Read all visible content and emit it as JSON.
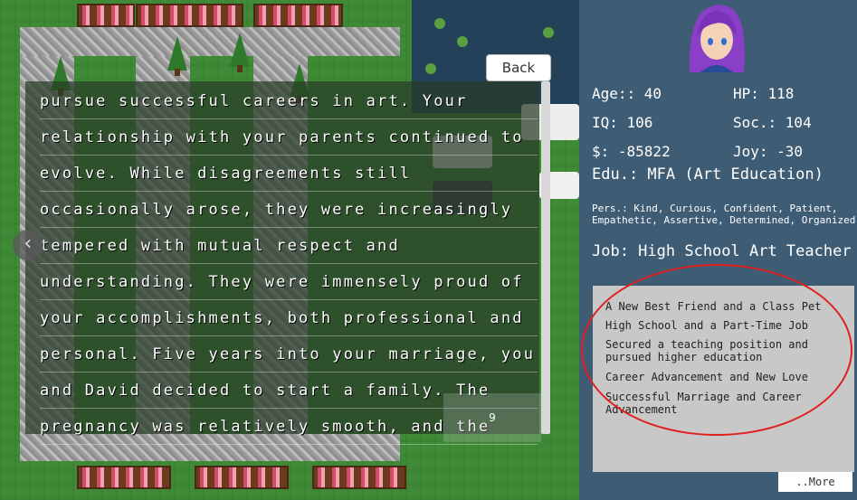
{
  "story": {
    "lines": [
      "pursue successful careers in art.  Your",
      "relationship with your parents continued to",
      "evolve.  While disagreements still",
      "occasionally arose, they were increasingly",
      "tempered with mutual respect and",
      "understanding.  They were immensely proud of",
      "your accomplishments, both professional and",
      "personal.  Five years into your marriage, you",
      "and David decided to start a family. The",
      "pregnancy was relatively smooth, and the"
    ],
    "page_number": "9"
  },
  "nav": {
    "back_label": "Back",
    "prev_arrow": "‹"
  },
  "stats": {
    "age": "Age:: 40",
    "hp": "HP: 118",
    "iq": "IQ: 106",
    "soc": "Soc.: 104",
    "money": "$: -85822",
    "joy": "Joy: -30",
    "edu": "Edu.: MFA (Art Education)",
    "pers": "Pers.: Kind, Curious, Confident, Patient, Empathetic, Assertive, Determined, Organized",
    "job": "Job: High School Art Teacher"
  },
  "events": [
    "A New Best Friend and a Class Pet",
    "High School and a Part-Time Job",
    "Secured a teaching position and pursued higher education",
    "Career Advancement and New Love",
    "Successful Marriage and Career Advancement"
  ],
  "more_label": "..More",
  "colors": {
    "panel_bg": "#3e5c74",
    "annotation_circle": "#e02020",
    "avatar_hair": "#8a3fc8"
  }
}
